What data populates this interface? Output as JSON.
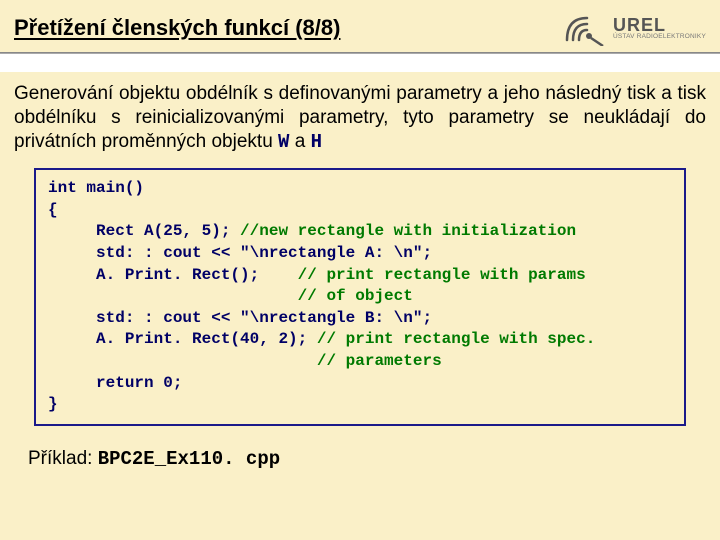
{
  "header": {
    "title": "Přetížení členských funkcí (8/8)",
    "logo": {
      "brand": "UREL",
      "sub": "ÚSTAV RADIOELEKTRONIKY"
    }
  },
  "paragraph": {
    "text_before": "Generování objektu obdélník s definovanými parametry a jeho následný tisk a tisk obdélníku s reinicializovanými parametry, tyto parametry se neukládají do privátních proměnných objektu ",
    "var1": "W",
    "between": " a ",
    "var2": "H"
  },
  "code": {
    "l1": "int main()",
    "l2": "{",
    "l3a": "     Rect A(25, 5); ",
    "l3c": "//new rectangle with initialization",
    "l4": "     std: : cout << \"\\nrectangle A: \\n\";",
    "l5a": "     A. Print. Rect();    ",
    "l5c": "// print rectangle with params",
    "l6": "                          ",
    "l6c": "// of object",
    "l7": "     std: : cout << \"\\nrectangle B: \\n\";",
    "l8a": "     A. Print. Rect(40, 2); ",
    "l8c": "// print rectangle with spec.",
    "l9": "                            ",
    "l9c": "// parameters",
    "l10": "     return 0;",
    "l11": "}"
  },
  "footer": {
    "label": "Příklad: ",
    "file": "BPC2E_Ex110. cpp"
  }
}
